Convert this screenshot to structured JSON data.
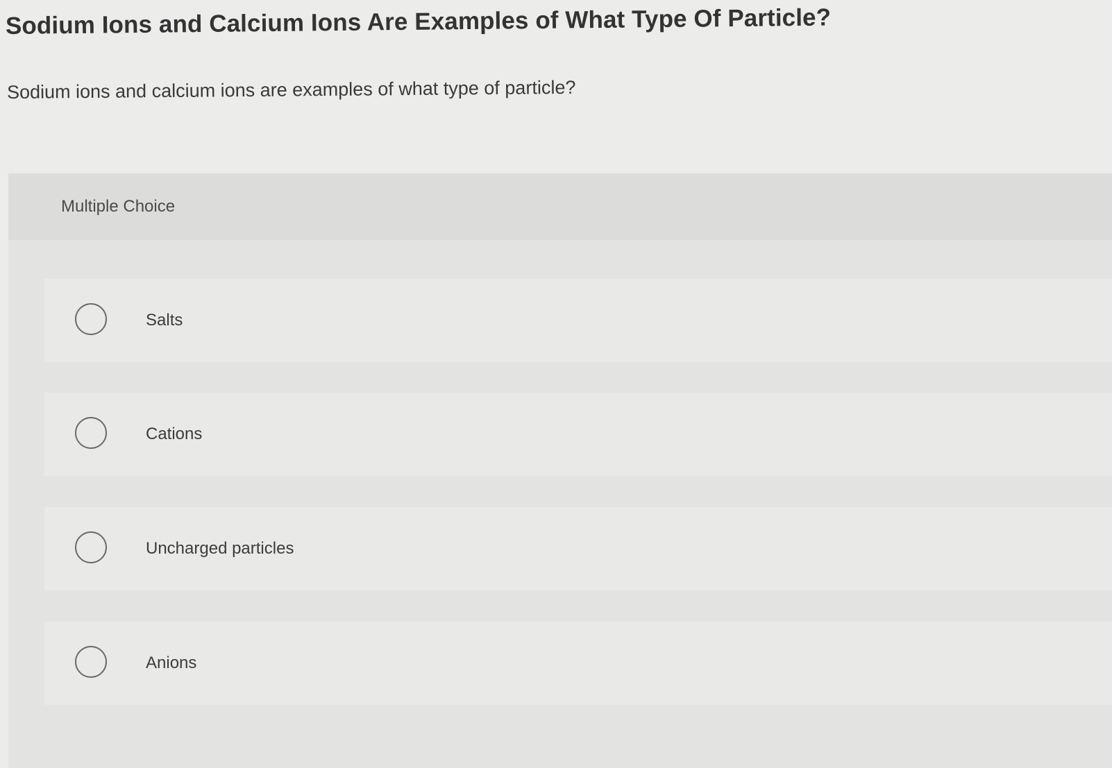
{
  "page": {
    "title": "Sodium Ions and Calcium Ions Are Examples of What Type Of Particle?",
    "question": "Sodium ions and calcium ions are examples of what type of particle?"
  },
  "question_panel": {
    "type_label": "Multiple Choice",
    "choices": [
      {
        "label": "Salts",
        "selected": false
      },
      {
        "label": "Cations",
        "selected": false
      },
      {
        "label": "Uncharged particles",
        "selected": false
      },
      {
        "label": "Anions",
        "selected": false
      }
    ]
  },
  "colors": {
    "page_background": "#ececea",
    "panel_background": "#e3e3e1",
    "panel_header_background": "#dcdcdb",
    "choice_background": "#e9e9e7",
    "radio_border": "#6b6b6b",
    "title_text": "#333333"
  },
  "icons": {
    "radio_unselected": "radio-unselected-icon"
  }
}
